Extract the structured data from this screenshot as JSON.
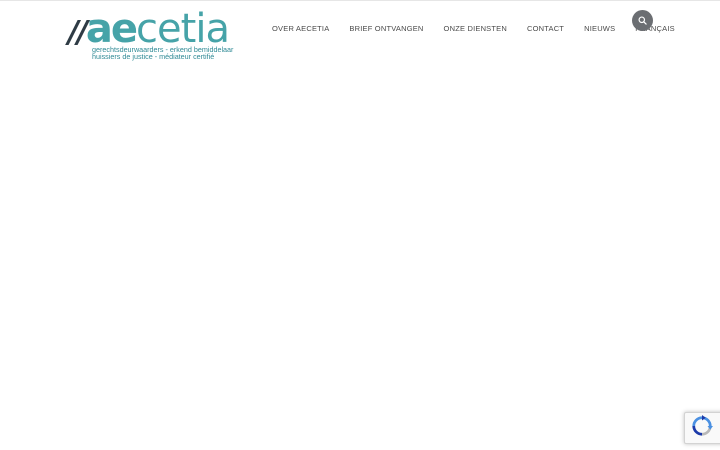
{
  "logo": {
    "slashes": "//",
    "ae": "ae",
    "cetia": "cetia",
    "tagline_line1": "gerechtsdeurwaarders - erkend bemiddelaar",
    "tagline_line2": "huissiers de justice - médiateur certifié",
    "colors": {
      "teal": "#46a3a8",
      "dark": "#2f3b45"
    }
  },
  "nav": {
    "items": [
      {
        "label": "OVER AECETIA"
      },
      {
        "label": "BRIEF ONTVANGEN"
      },
      {
        "label": "ONZE DIENSTEN"
      },
      {
        "label": "CONTACT"
      },
      {
        "label": "NIEUWS"
      },
      {
        "label": "FRANÇAIS"
      }
    ]
  },
  "search": {
    "icon": "search-icon",
    "color": "#6b6e72"
  },
  "recaptcha": {
    "icon": "recaptcha-icon"
  }
}
